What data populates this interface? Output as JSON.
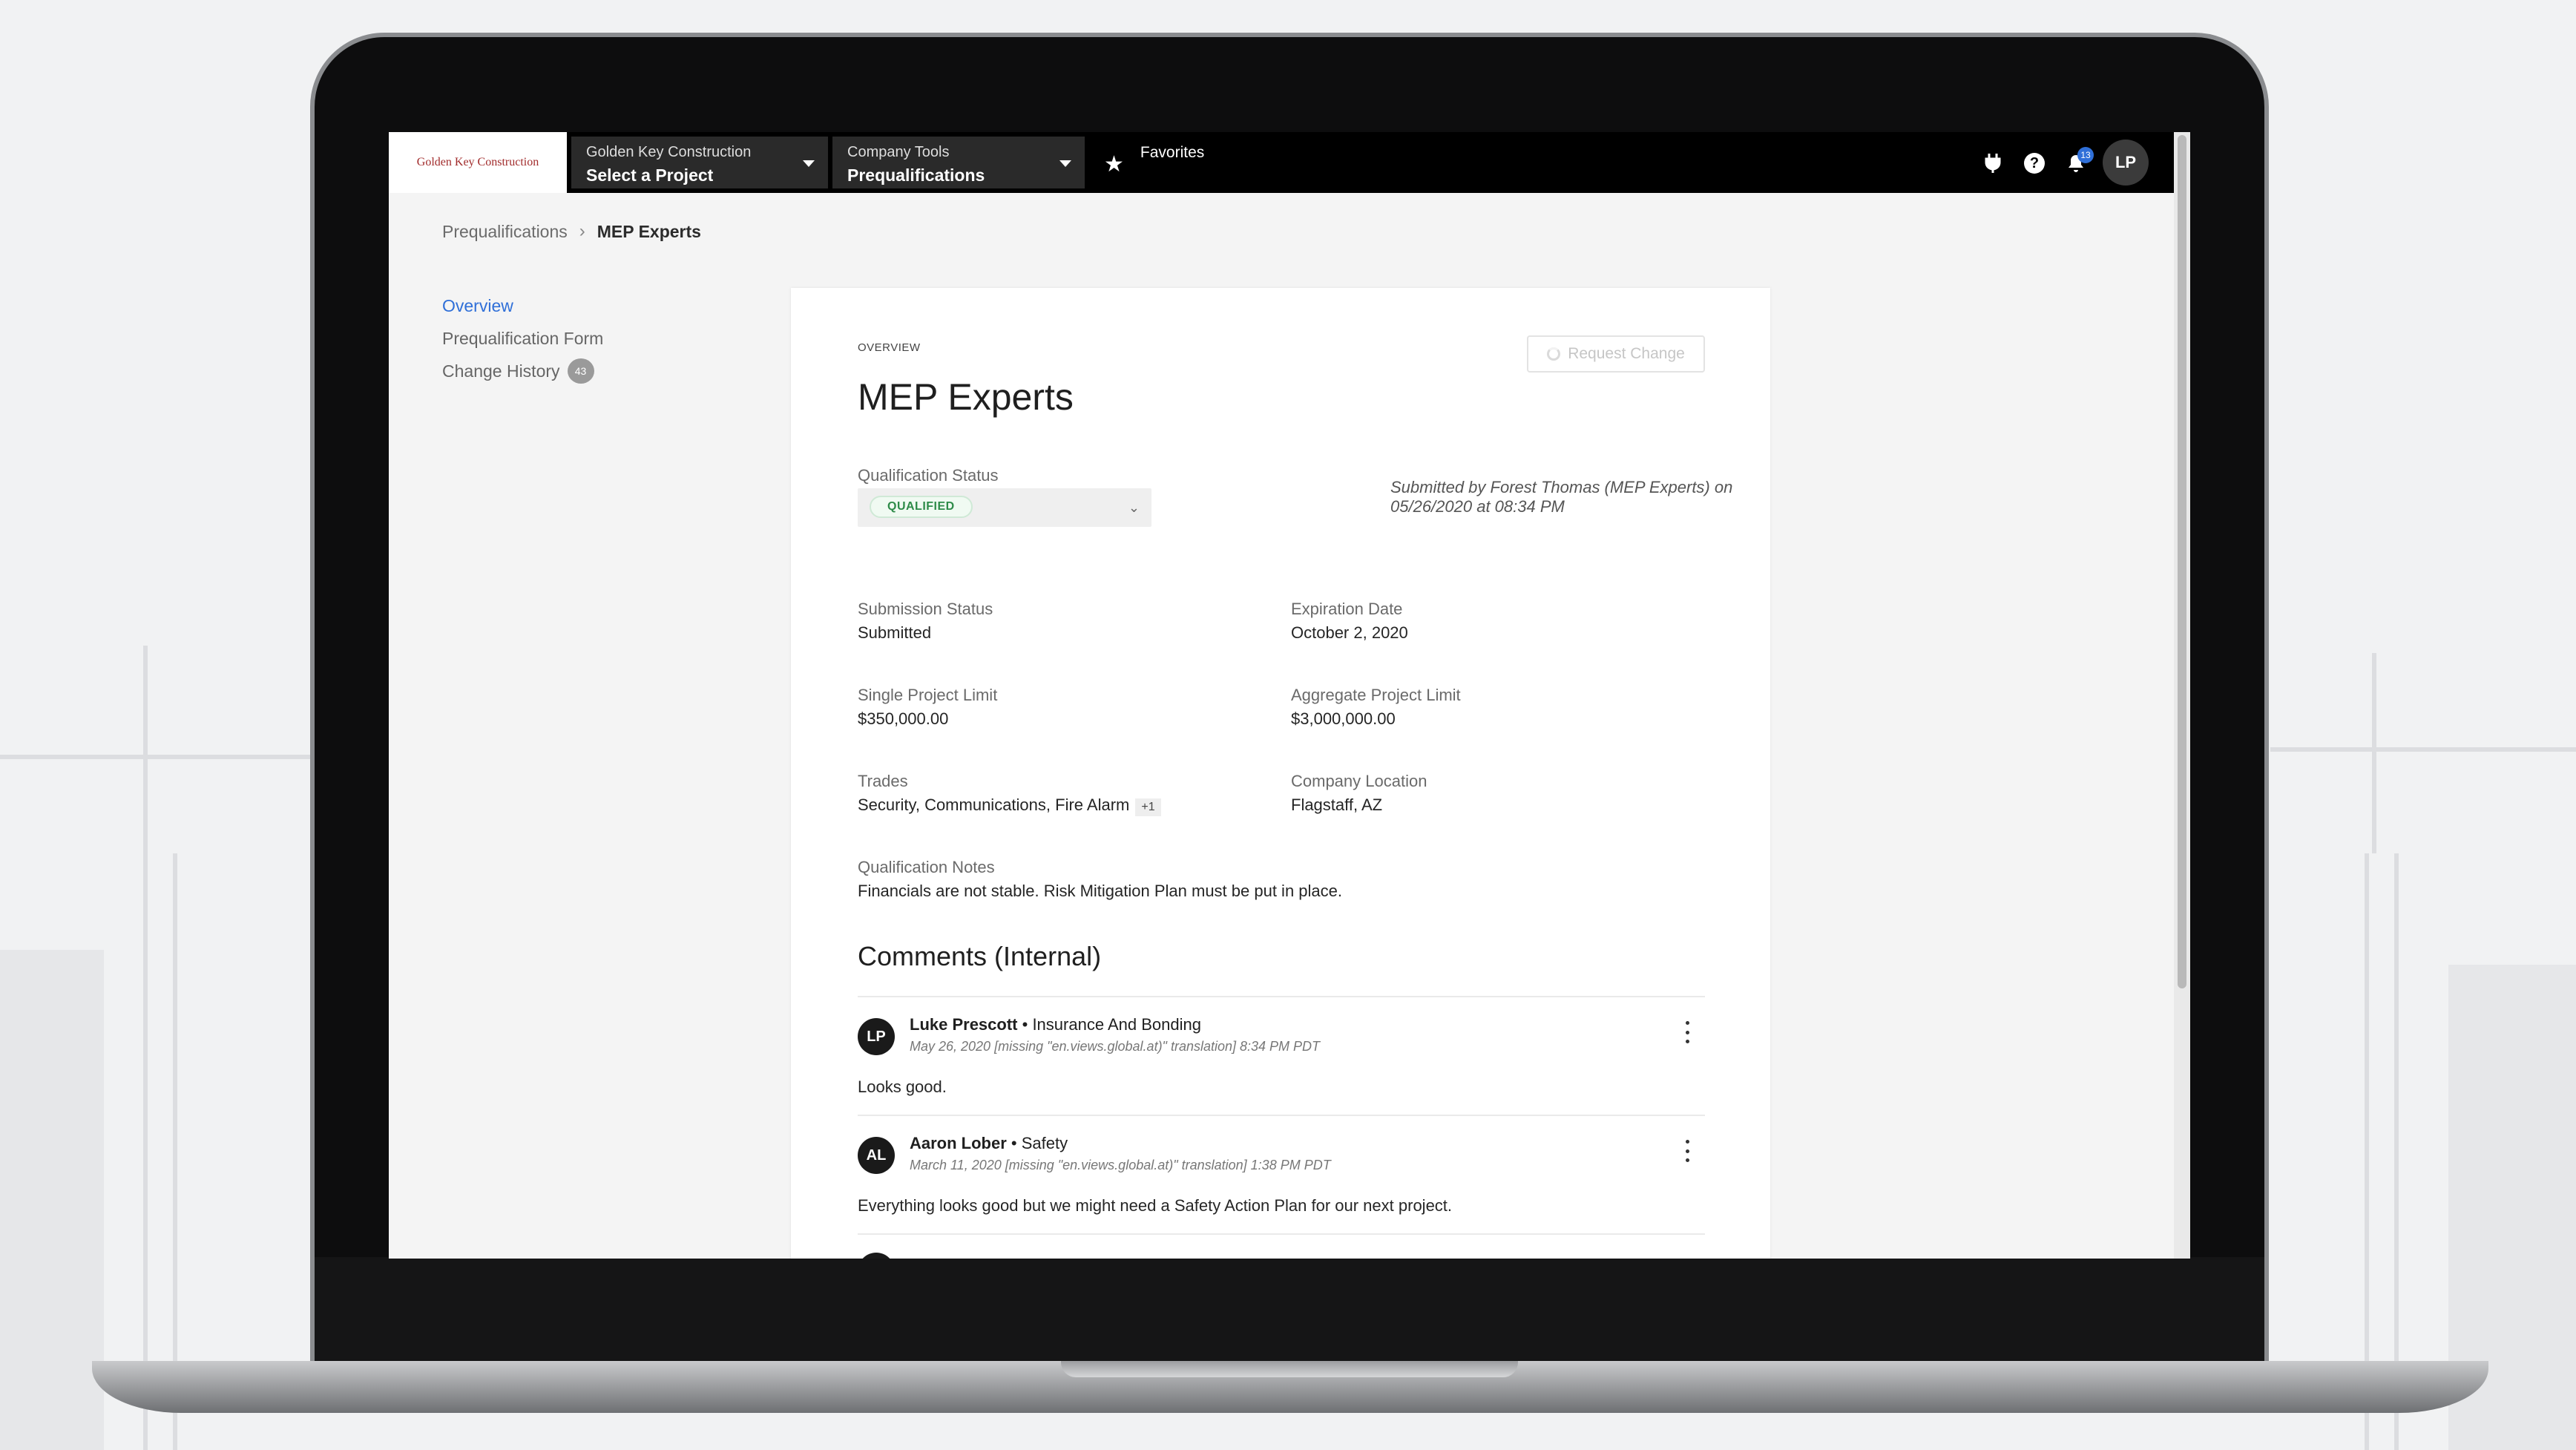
{
  "nav": {
    "logo_text": "Golden Key Construction",
    "company_name": "Golden Key Construction",
    "project_select": "Select a Project",
    "tools_label": "Company Tools",
    "tools_value": "Prequalifications",
    "favorites": "Favorites",
    "notification_count": "13",
    "user_initials": "LP"
  },
  "breadcrumb": {
    "parent": "Prequalifications",
    "current": "MEP Experts"
  },
  "sidebar": {
    "items": [
      {
        "label": "Overview",
        "active": true
      },
      {
        "label": "Prequalification Form"
      },
      {
        "label": "Change History",
        "badge": "43"
      }
    ]
  },
  "overview": {
    "section_label": "OVERVIEW",
    "request_change": "Request Change",
    "title": "MEP Experts",
    "qualification_status_label": "Qualification Status",
    "qualification_status": "QUALIFIED",
    "submitted_by": "Submitted by Forest Thomas (MEP Experts) on 05/26/2020 at 08:34 PM",
    "fields": {
      "submission_status_label": "Submission Status",
      "submission_status": "Submitted",
      "expiration_date_label": "Expiration Date",
      "expiration_date": "October 2, 2020",
      "single_limit_label": "Single Project Limit",
      "single_limit": "$350,000.00",
      "aggregate_limit_label": "Aggregate Project Limit",
      "aggregate_limit": "$3,000,000.00",
      "trades_label": "Trades",
      "trades": "Security, Communications, Fire Alarm",
      "trades_more": "+1",
      "location_label": "Company Location",
      "location": "Flagstaff, AZ",
      "notes_label": "Qualification Notes",
      "notes": "Financials are not stable. Risk Mitigation Plan must be put in place."
    }
  },
  "comments": {
    "title": "Comments (Internal)",
    "items": [
      {
        "initials": "LP",
        "author": "Luke Prescott",
        "role": "• Insurance And Bonding",
        "date": "May 26, 2020 [missing \"en.views.global.at)\" translation] 8:34 PM PDT",
        "body": "Looks good."
      },
      {
        "initials": "AL",
        "author": "Aaron Lober",
        "role": "• Safety",
        "date": "March 11, 2020 [missing \"en.views.global.at)\" translation] 1:38 PM PDT",
        "body": "Everything looks good but we might need a Safety Action Plan for our next project."
      }
    ]
  },
  "colors": {
    "accent": "#2f6fd8",
    "status_green": "#2e8b49",
    "nav_bg": "#000000"
  }
}
